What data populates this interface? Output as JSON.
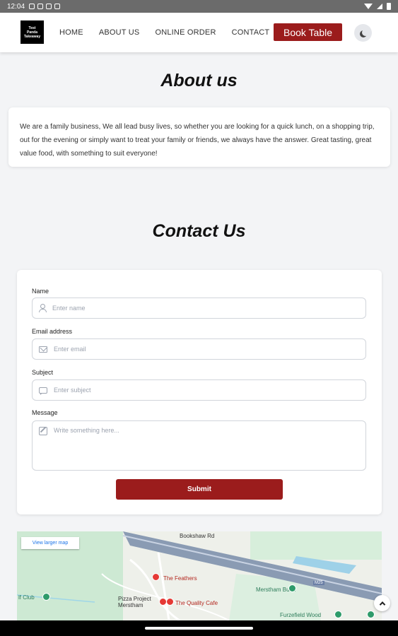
{
  "status": {
    "time": "12:04"
  },
  "header": {
    "logo_lines": [
      "Test",
      "Panda",
      "Takeaway"
    ],
    "nav": [
      "HOME",
      "ABOUT US",
      "ONLINE ORDER",
      "CONTACT"
    ],
    "book_label": "Book Table",
    "accent": "#9b1c1c"
  },
  "about": {
    "title": "About us",
    "text": "We are a family business, We all lead busy lives, so whether you are looking for a quick lunch, on a shopping trip, out for the evening or simply want to treat your family or friends, we always have the answer. Great tasting, great value food, with something to suit everyone!"
  },
  "contact": {
    "title": "Contact Us",
    "name_label": "Name",
    "name_placeholder": "Enter name",
    "email_label": "Email address",
    "email_placeholder": "Enter email",
    "subject_label": "Subject",
    "subject_placeholder": "Enter subject",
    "message_label": "Message",
    "message_placeholder": "Write something here...",
    "submit_label": "Submit"
  },
  "map": {
    "larger_map": "View larger map",
    "labels": {
      "bookshaw": "Bookshaw Rd",
      "feathers": "The Feathers",
      "pizza": "Pizza Project\nMerstham",
      "quality": "The Quality Cafe",
      "merstham_bund": "Merstham Bund",
      "furzefield": "Furzefield Wood",
      "golf": "lf Club",
      "m25": "M25"
    }
  }
}
